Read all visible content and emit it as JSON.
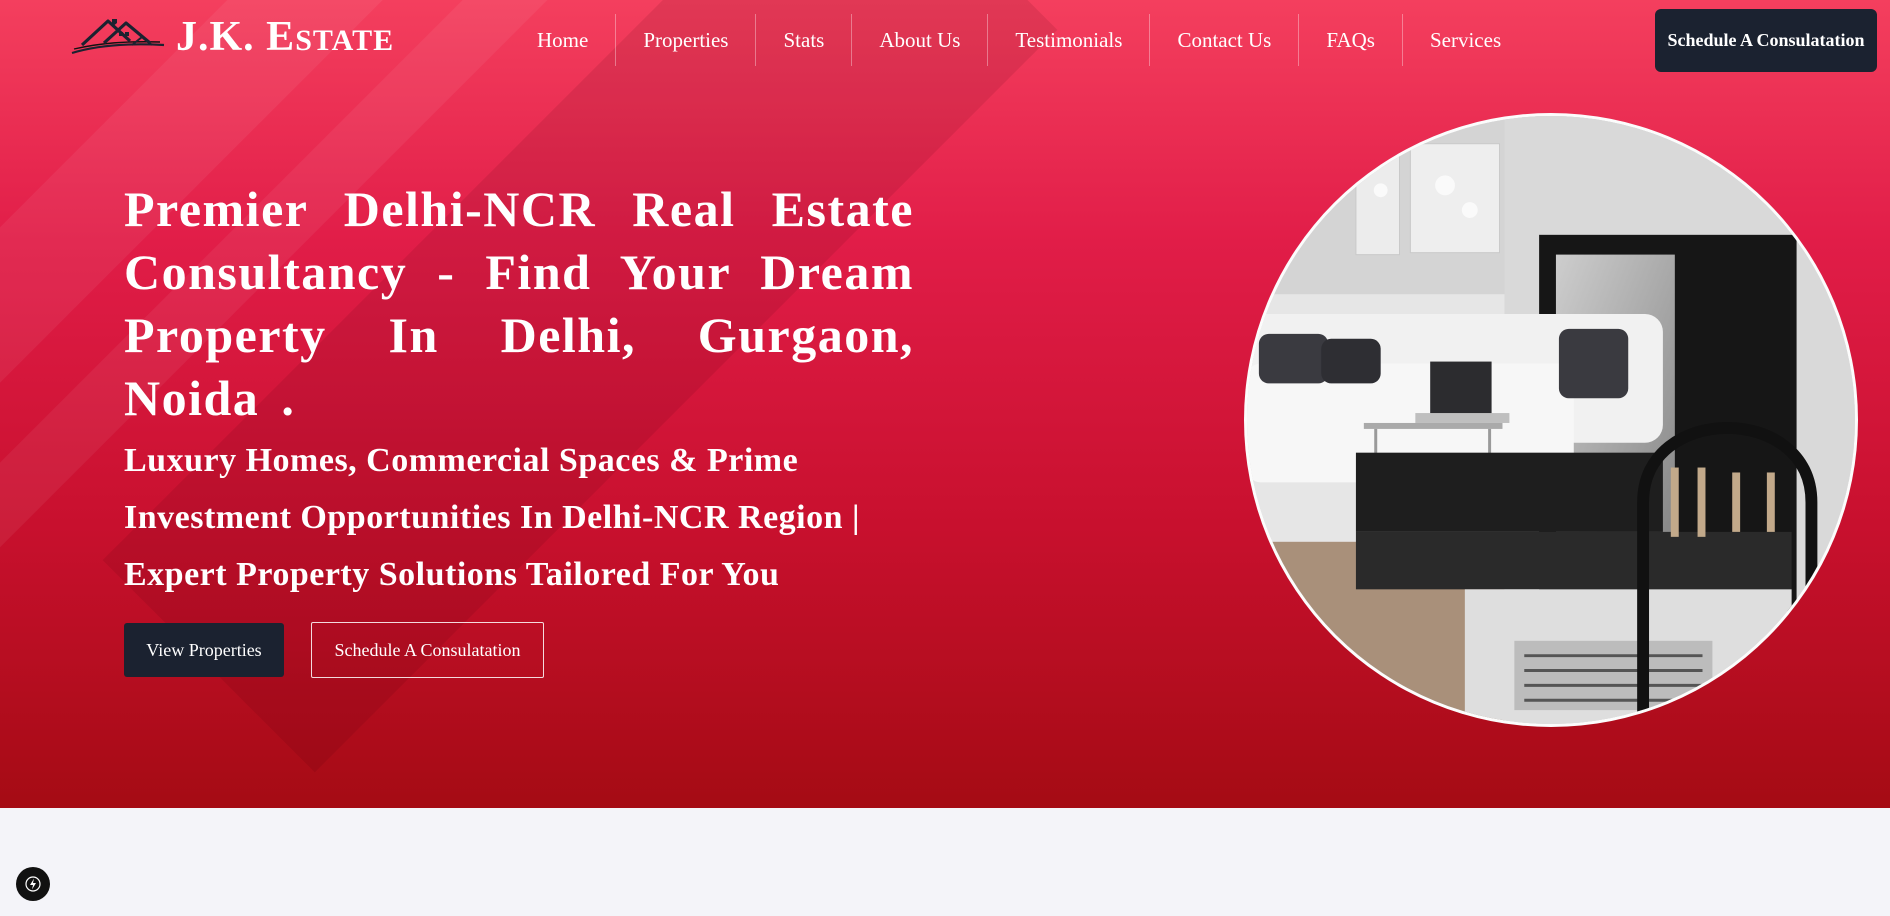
{
  "brand": {
    "name_first": "J.K. E",
    "name_rest": "STATE"
  },
  "nav": {
    "items": [
      "Home",
      "Properties",
      "Stats",
      "About Us",
      "Testimonials",
      "Contact Us",
      "FAQs",
      "Services"
    ],
    "cta_label": "Schedule A Consulatation"
  },
  "hero": {
    "title": "Premier Delhi-NCR Real Estate Consultancy - Find Your Dream Property In Delhi, Gurgaon, Noida",
    "title_end": ".",
    "subtitle": "Luxury Homes, Commercial Spaces & Prime Investment Opportunities In Delhi-NCR Region | Expert Property Solutions Tailored For You",
    "primary_button": "View Properties",
    "secondary_button": "Schedule A Consulatation"
  },
  "icons": {
    "logo": "house-roof-logo",
    "fab": "lightning-icon"
  },
  "colors": {
    "hero_top": "#f43f5e",
    "hero_bottom": "#a50b14",
    "dark_button": "#1b2230",
    "page_bg": "#f4f4f9"
  }
}
